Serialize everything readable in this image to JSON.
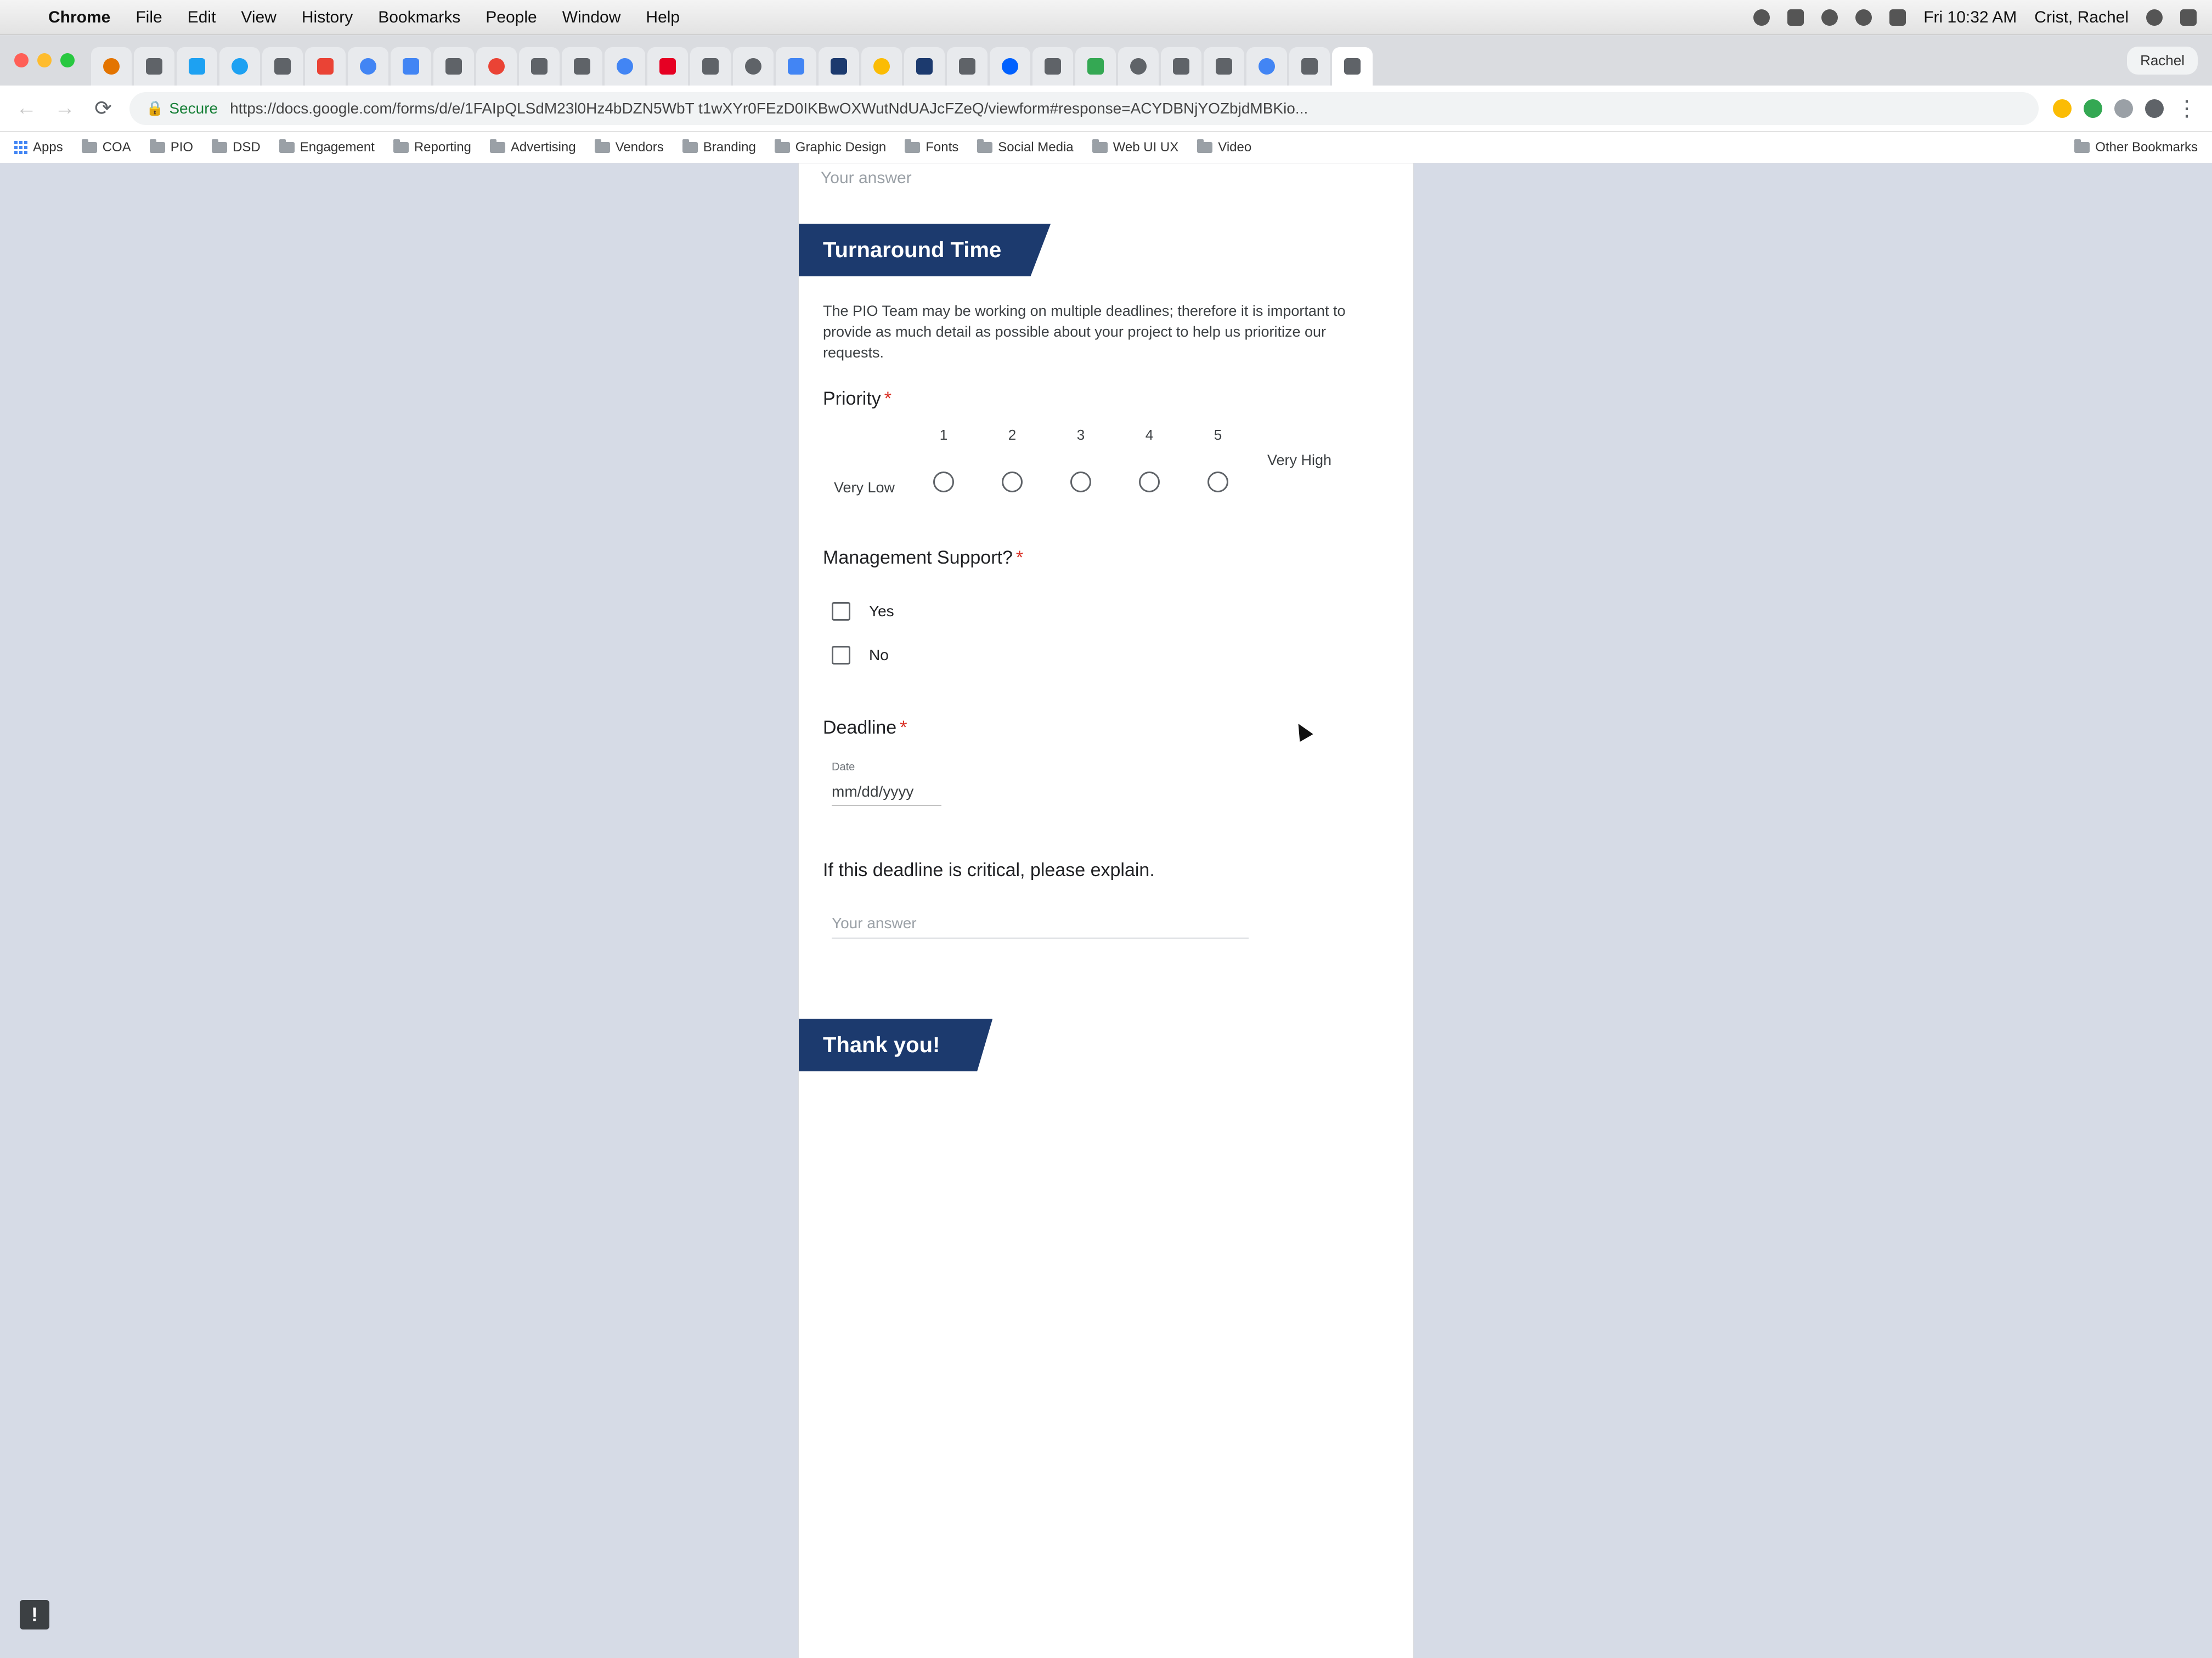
{
  "menubar": {
    "apple": "",
    "items": [
      "Chrome",
      "File",
      "Edit",
      "View",
      "History",
      "Bookmarks",
      "People",
      "Window",
      "Help"
    ],
    "clock": "Fri 10:32 AM",
    "user": "Crist, Rachel"
  },
  "tabs": {
    "user_chip": "Rachel",
    "favicons": [
      "#e37400",
      "#5f6368",
      "#1da1f2",
      "#1da1f2",
      "#5f6368",
      "#ea4335",
      "#4285f4",
      "#4285f4",
      "#5f6368",
      "#ea4335",
      "#5f6368",
      "#5f6368",
      "#4285f4",
      "#e60023",
      "#5f6368",
      "#5f6368",
      "#4285f4",
      "#1c3a6e",
      "#fbbc04",
      "#1c3a6e",
      "#5f6368",
      "#0061ff",
      "#5f6368",
      "#34a853",
      "#5f6368",
      "#5f6368",
      "#5f6368",
      "#4285f4",
      "#5f6368",
      "#5f6368"
    ],
    "active_index": 29
  },
  "toolbar": {
    "back": "←",
    "forward": "→",
    "reload": "⟳",
    "secure_label": "Secure",
    "url": "https://docs.google.com/forms/d/e/1FAIpQLSdM23l0Hz4bDZN5WbT t1wXYr0FEzD0IKBwOXWutNdUAJcFZeQ/viewform#response=ACYDBNjYOZbjdMBKio...",
    "menu": "⋮"
  },
  "bookmarks": {
    "apps": "Apps",
    "items": [
      "COA",
      "PIO",
      "DSD",
      "Engagement",
      "Reporting",
      "Advertising",
      "Vendors",
      "Branding",
      "Graphic Design",
      "Fonts",
      "Social Media",
      "Web UI UX",
      "Video"
    ],
    "other": "Other Bookmarks"
  },
  "form": {
    "prev_answer_placeholder": "Your answer",
    "section_title": "Turnaround Time",
    "section_description": "The PIO Team may be working on multiple deadlines; therefore it is important to provide as much detail as possible about your project to help us prioritize our requests.",
    "priority": {
      "label": "Priority",
      "required_mark": "*",
      "low_label": "Very Low",
      "high_label": "Very High",
      "scale": [
        "1",
        "2",
        "3",
        "4",
        "5"
      ]
    },
    "management": {
      "label": "Management Support?",
      "required_mark": "*",
      "options": [
        "Yes",
        "No"
      ]
    },
    "deadline": {
      "label": "Deadline",
      "required_mark": "*",
      "caption": "Date",
      "placeholder": "mm/dd/yyyy"
    },
    "critical": {
      "label": "If this deadline is critical, please explain.",
      "placeholder": "Your answer"
    },
    "final_section_title": "Thank you!",
    "feedback_icon": "!"
  }
}
